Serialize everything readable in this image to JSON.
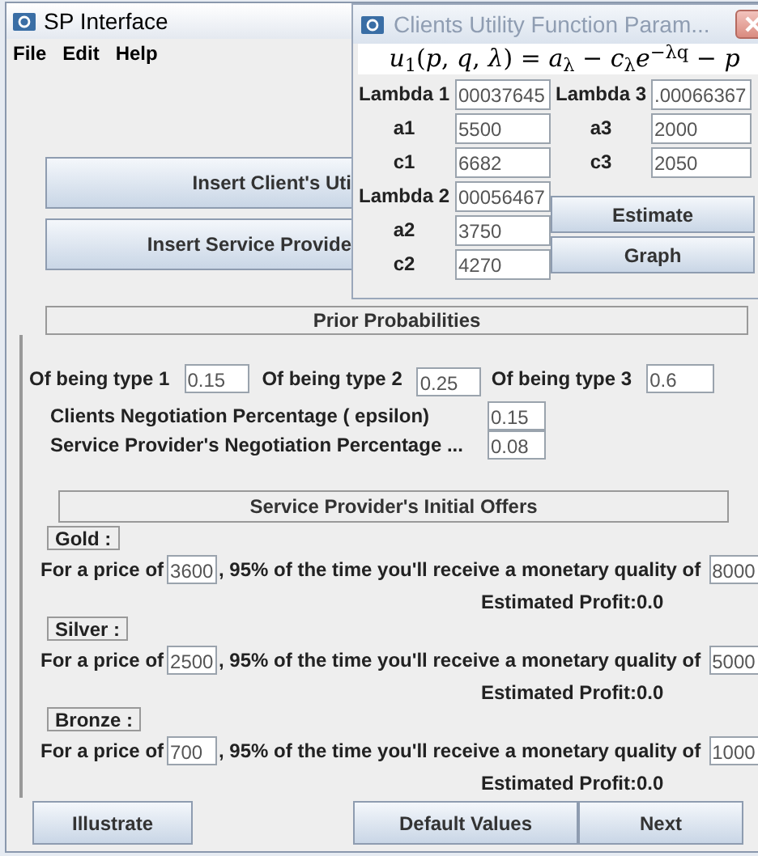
{
  "window": {
    "title": "SP Interface"
  },
  "menu": [
    "File",
    "Edit",
    "Help"
  ],
  "main_buttons": [
    "Insert Client's Uti",
    "Insert Service Provide"
  ],
  "dialog": {
    "title": "Clients Utility Function Param...",
    "formula": "*u*$_{1}$(*p*, *q*, *λ*) = *a*$_{λ}$ − *c*$_{λ}$*e*$^{−λq}$ − *p*",
    "left_fields": [
      {
        "label": "Lambda 1",
        "value": "00037645"
      },
      {
        "label": "a1",
        "value": "5500"
      },
      {
        "label": "c1",
        "value": "6682"
      },
      {
        "label": "Lambda 2",
        "value": "00056467"
      },
      {
        "label": "a2",
        "value": "3750"
      },
      {
        "label": "c2",
        "value": "4270"
      }
    ],
    "right_fields": [
      {
        "label": "Lambda 3",
        "value": ".00066367"
      },
      {
        "label": "a3",
        "value": "2000"
      },
      {
        "label": "c3",
        "value": "2050"
      }
    ],
    "buttons": [
      "Estimate",
      "Graph"
    ]
  },
  "prior_probabilities": {
    "title": "Prior Probabilities",
    "types": [
      {
        "label": "Of being type 1",
        "value": "0.15"
      },
      {
        "label": "Of being type 2",
        "value": "0.25"
      },
      {
        "label": "Of being type 3",
        "value": "0.6"
      }
    ],
    "negotiation": [
      {
        "label": "Clients Negotiation Percentage ( epsilon)",
        "value": "0.15"
      },
      {
        "label": "Service Provider's  Negotiation Percentage ...",
        "value": "0.08"
      }
    ]
  },
  "initial_offers": {
    "title": "Service Provider's Initial Offers",
    "offers": [
      {
        "tier": "Gold :",
        "prefix": "For a price of",
        "price": "3600",
        "middle": ", 95% of the time you'll receive a monetary quality of",
        "quality": "8000",
        "profit": "Estimated Profit:0.0"
      },
      {
        "tier": "Silver :",
        "prefix": "For a price of",
        "price": "2500",
        "middle": ", 95% of the time you'll receive a monetary quality of",
        "quality": "5000",
        "profit": "Estimated Profit:0.0"
      },
      {
        "tier": "Bronze :",
        "prefix": "For a price of",
        "price": "700",
        "middle": ", 95% of the time you'll receive a monetary quality of",
        "quality": "1000",
        "profit": "Estimated Profit:0.0"
      }
    ]
  },
  "footer_buttons": [
    "Illustrate",
    "Default Values",
    "Next"
  ]
}
